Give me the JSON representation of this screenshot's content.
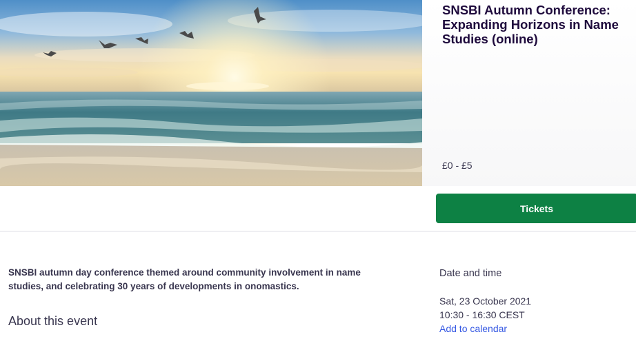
{
  "event": {
    "title": "SNSBI Autumn Conference: Expanding Horizons in Name Studies (online)",
    "price_range": "£0 - £5",
    "hero_image": "beach-sunset-with-seagulls-photo"
  },
  "tickets": {
    "button_label": "Tickets",
    "button_color": "#0d8144"
  },
  "description": {
    "summary": "SNSBI autumn day conference themed around community involvement in name studies, and celebrating 30 years of developments in onomastics.",
    "about_heading": "About this event"
  },
  "date_time": {
    "heading": "Date and time",
    "date": "Sat, 23 October 2021",
    "time": "10:30 - 16:30 CEST",
    "add_to_calendar": "Add to calendar",
    "link_color": "#3659e3"
  }
}
